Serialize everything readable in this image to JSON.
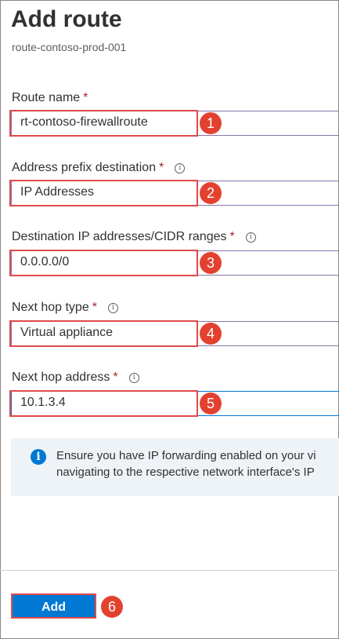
{
  "header": {
    "title": "Add route",
    "subtitle": "route-contoso-prod-001"
  },
  "required_marker": "*",
  "info_glyph": "i",
  "fields": [
    {
      "label": "Route name",
      "value": "rt-contoso-firewallroute",
      "badge": "1"
    },
    {
      "label": "Address prefix destination",
      "value": "IP Addresses",
      "badge": "2"
    },
    {
      "label": "Destination IP addresses/CIDR ranges",
      "value": "0.0.0.0/0",
      "badge": "3"
    },
    {
      "label": "Next hop type",
      "value": "Virtual appliance",
      "badge": "4"
    },
    {
      "label": "Next hop address",
      "value": "10.1.3.4",
      "badge": "5"
    }
  ],
  "info_panel": {
    "line1": "Ensure you have IP forwarding enabled on your vi",
    "line2": "navigating to the respective network interface's IP"
  },
  "footer": {
    "add_label": "Add",
    "badge": "6"
  },
  "colors": {
    "accent": "#0078d4",
    "annotation": "#e3412f",
    "required": "#a4262c"
  }
}
